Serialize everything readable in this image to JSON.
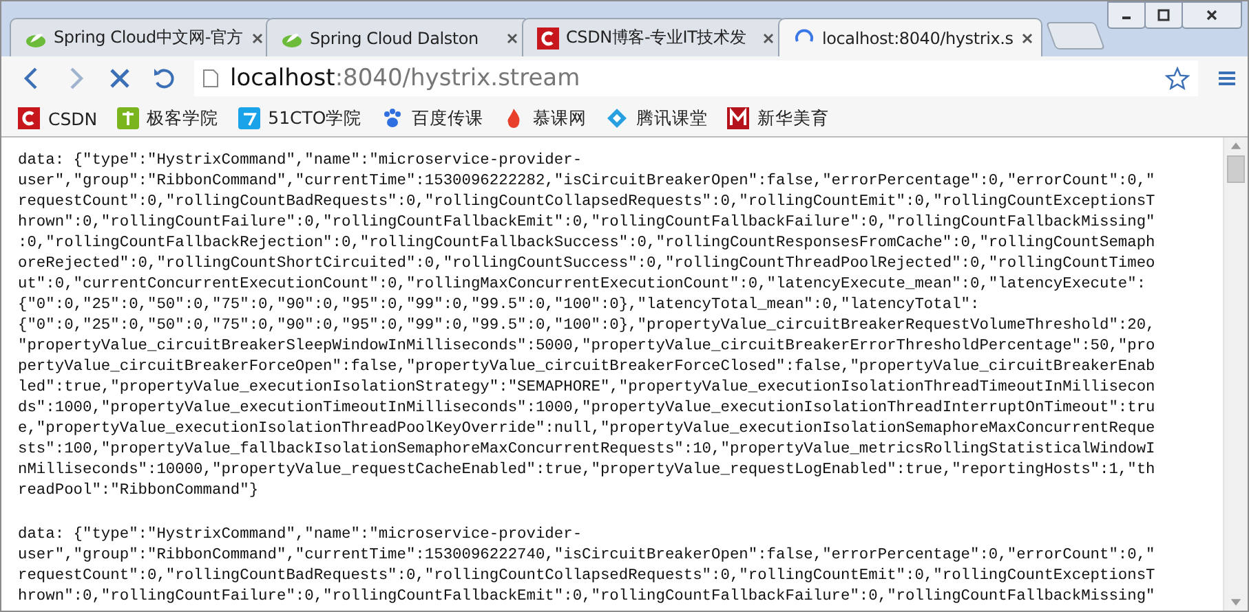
{
  "tabs": [
    {
      "title": "Spring Cloud中文网-官方",
      "selected": false
    },
    {
      "title": "Spring Cloud Dalston",
      "selected": false
    },
    {
      "title": "CSDN博客-专业IT技术发",
      "selected": false
    },
    {
      "title": "localhost:8040/hystrix.s",
      "selected": true
    }
  ],
  "address": {
    "host": "localhost",
    "path": ":8040/hystrix.stream"
  },
  "bookmarks": [
    {
      "label": "CSDN"
    },
    {
      "label": "极客学院"
    },
    {
      "label": "51CTO学院"
    },
    {
      "label": "百度传课"
    },
    {
      "label": "慕课网"
    },
    {
      "label": "腾讯课堂"
    },
    {
      "label": "新华美育"
    }
  ],
  "events": [
    {
      "lines": [
        "data: {\"type\":\"HystrixCommand\",\"name\":\"microservice-provider-",
        "user\",\"group\":\"RibbonCommand\",\"currentTime\":1530096222282,\"isCircuitBreakerOpen\":false,\"errorPercentage\":0,\"errorCount\":0,\"",
        "requestCount\":0,\"rollingCountBadRequests\":0,\"rollingCountCollapsedRequests\":0,\"rollingCountEmit\":0,\"rollingCountExceptionsT",
        "hrown\":0,\"rollingCountFailure\":0,\"rollingCountFallbackEmit\":0,\"rollingCountFallbackFailure\":0,\"rollingCountFallbackMissing\"",
        ":0,\"rollingCountFallbackRejection\":0,\"rollingCountFallbackSuccess\":0,\"rollingCountResponsesFromCache\":0,\"rollingCountSemaph",
        "oreRejected\":0,\"rollingCountShortCircuited\":0,\"rollingCountSuccess\":0,\"rollingCountThreadPoolRejected\":0,\"rollingCountTimeo",
        "ut\":0,\"currentConcurrentExecutionCount\":0,\"rollingMaxConcurrentExecutionCount\":0,\"latencyExecute_mean\":0,\"latencyExecute\":",
        "{\"0\":0,\"25\":0,\"50\":0,\"75\":0,\"90\":0,\"95\":0,\"99\":0,\"99.5\":0,\"100\":0},\"latencyTotal_mean\":0,\"latencyTotal\":",
        "{\"0\":0,\"25\":0,\"50\":0,\"75\":0,\"90\":0,\"95\":0,\"99\":0,\"99.5\":0,\"100\":0},\"propertyValue_circuitBreakerRequestVolumeThreshold\":20,",
        "\"propertyValue_circuitBreakerSleepWindowInMilliseconds\":5000,\"propertyValue_circuitBreakerErrorThresholdPercentage\":50,\"pro",
        "pertyValue_circuitBreakerForceOpen\":false,\"propertyValue_circuitBreakerForceClosed\":false,\"propertyValue_circuitBreakerEnab",
        "led\":true,\"propertyValue_executionIsolationStrategy\":\"SEMAPHORE\",\"propertyValue_executionIsolationThreadTimeoutInMillisecon",
        "ds\":1000,\"propertyValue_executionTimeoutInMilliseconds\":1000,\"propertyValue_executionIsolationThreadInterruptOnTimeout\":tru",
        "e,\"propertyValue_executionIsolationThreadPoolKeyOverride\":null,\"propertyValue_executionIsolationSemaphoreMaxConcurrentReque",
        "sts\":100,\"propertyValue_fallbackIsolationSemaphoreMaxConcurrentRequests\":10,\"propertyValue_metricsRollingStatisticalWindowI",
        "nMilliseconds\":10000,\"propertyValue_requestCacheEnabled\":true,\"propertyValue_requestLogEnabled\":true,\"reportingHosts\":1,\"th",
        "readPool\":\"RibbonCommand\"}"
      ]
    },
    {
      "lines": [
        "data: {\"type\":\"HystrixCommand\",\"name\":\"microservice-provider-",
        "user\",\"group\":\"RibbonCommand\",\"currentTime\":1530096222740,\"isCircuitBreakerOpen\":false,\"errorPercentage\":0,\"errorCount\":0,\"",
        "requestCount\":0,\"rollingCountBadRequests\":0,\"rollingCountCollapsedRequests\":0,\"rollingCountEmit\":0,\"rollingCountExceptionsT",
        "hrown\":0,\"rollingCountFailure\":0,\"rollingCountFallbackEmit\":0,\"rollingCountFallbackFailure\":0,\"rollingCountFallbackMissing\""
      ]
    }
  ]
}
